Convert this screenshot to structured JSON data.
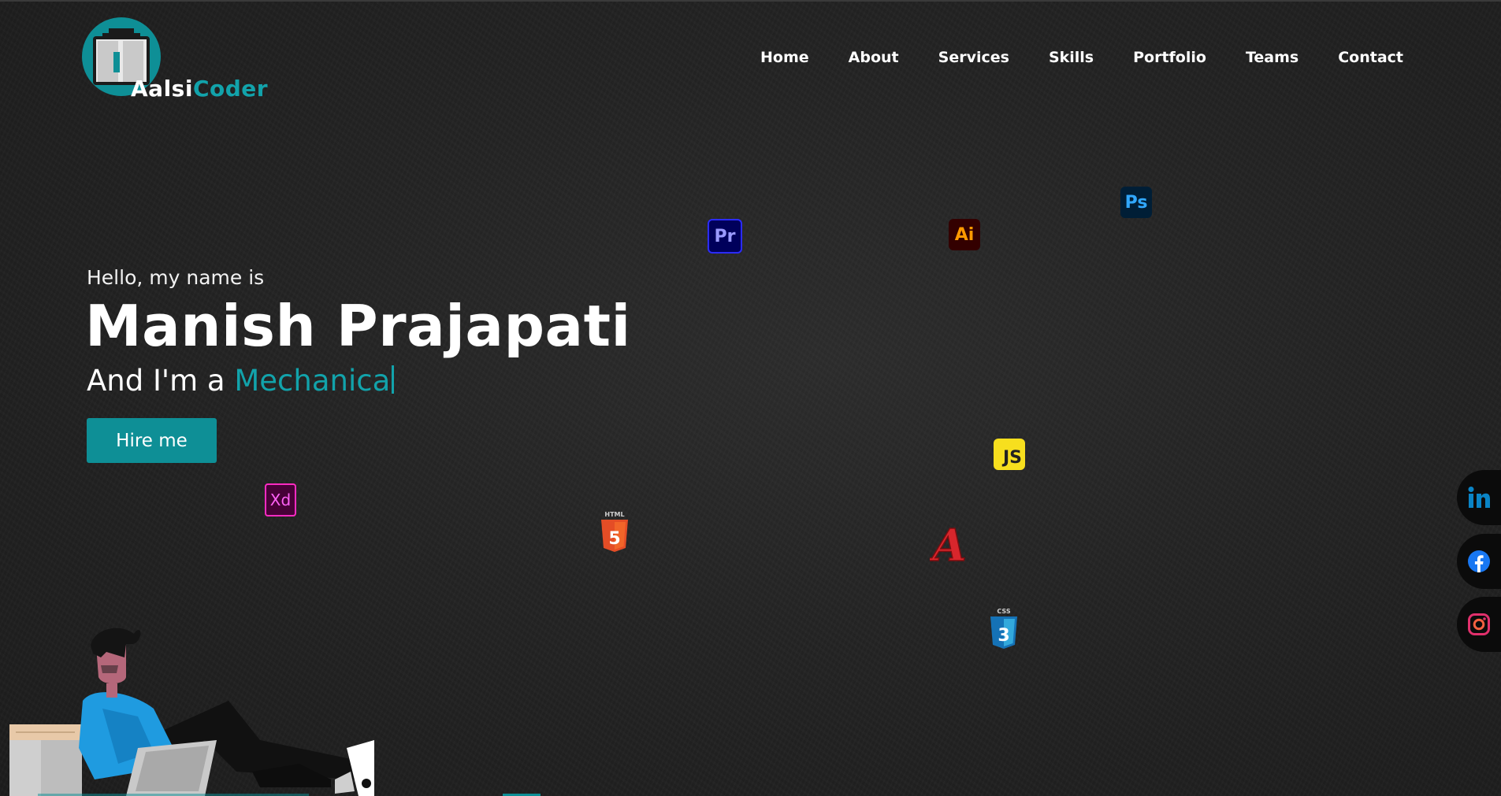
{
  "logo": {
    "letter": "A",
    "text_part1": "alsi",
    "text_part2": "Coder"
  },
  "nav": {
    "items": [
      "Home",
      "About",
      "Services",
      "Skills",
      "Portfolio",
      "Teams",
      "Contact"
    ]
  },
  "hero": {
    "greeting": "Hello, my name is",
    "name": "Manish Prajapati",
    "role_prefix": "And I'm a ",
    "role_typed": "Mechanica",
    "hire_label": "Hire me"
  },
  "tool_icons": {
    "premiere": "Pr",
    "illustrator": "Ai",
    "photoshop": "Ps",
    "javascript": "JS",
    "xd": "Xd",
    "html_caption": "HTML",
    "html_glyph": "5",
    "css_caption": "CSS",
    "css_glyph": "3",
    "autocad_glyph": "A"
  },
  "social": [
    "linkedin-icon",
    "facebook-icon",
    "instagram-icon"
  ],
  "colors": {
    "accent": "#0e8f96",
    "accent_text": "#12a3ab",
    "linkedin": "#0a84c6",
    "facebook": "#1877f2",
    "instagram": "#e1306c"
  }
}
